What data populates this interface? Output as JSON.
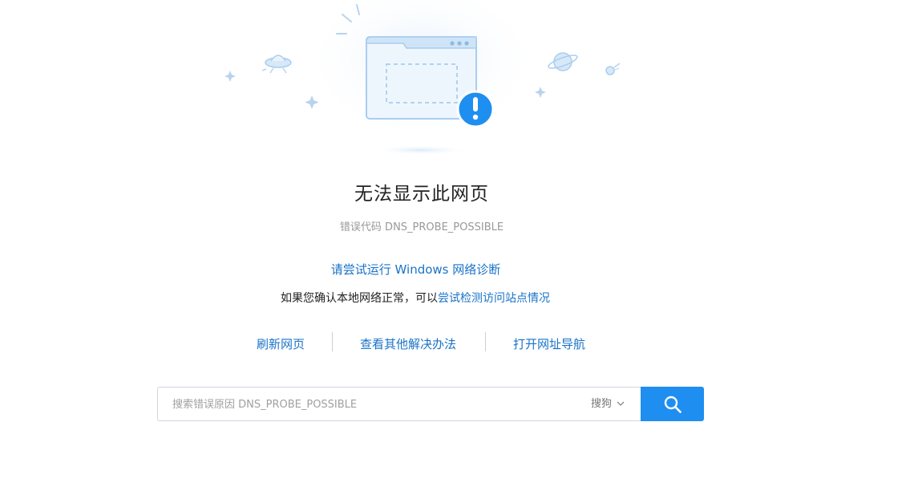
{
  "page": {
    "title": "无法显示此网页",
    "error_code": "错误代码 DNS_PROBE_POSSIBLE"
  },
  "diagnostics": {
    "run_diagnostics_link": "请尝试运行 Windows 网络诊断",
    "check_prefix": "如果您确认本地网络正常，可以",
    "check_link": "尝试检测访问站点情况"
  },
  "actions": {
    "refresh": "刷新网页",
    "other_solutions": "查看其他解决办法",
    "open_nav": "打开网址导航"
  },
  "search": {
    "placeholder": "搜索错误原因 DNS_PROBE_POSSIBLE",
    "value": "",
    "engine": "搜狗",
    "button_icon": "search-icon"
  },
  "colors": {
    "link": "#1a73c7",
    "accent": "#1f8ef1",
    "alert": "#1f8ef1"
  },
  "icons": {
    "illustration": "broken-webpage-icon",
    "alert": "exclamation-icon",
    "ufo": "ufo-icon",
    "planet": "planet-icon",
    "comet": "comet-icon",
    "sparkle": "sparkle-icon",
    "dropdown": "chevron-down-icon"
  }
}
